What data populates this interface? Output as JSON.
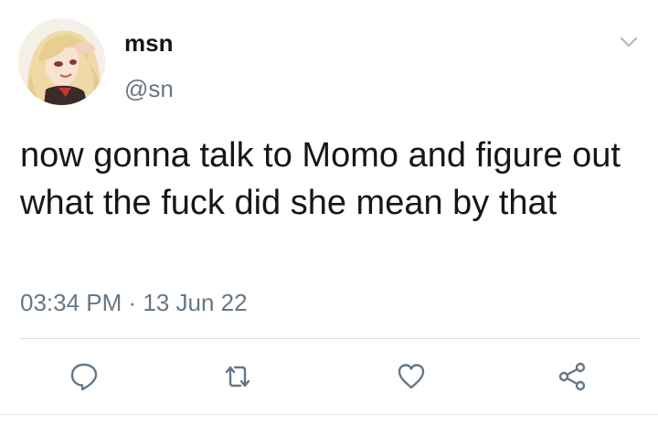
{
  "author": {
    "display_name": "msn",
    "handle": "@sn"
  },
  "tweet": {
    "text": "now gonna talk to Momo and figure out what the fuck did she mean by that",
    "timestamp": "03:34 PM · 13 Jun 22"
  },
  "icons": {
    "menu": "chevron-down-icon",
    "reply": "reply-icon",
    "retweet": "retweet-icon",
    "like": "heart-icon",
    "share": "share-icon"
  },
  "colors": {
    "text": "#14171a",
    "secondary": "#657786",
    "divider": "#d9dee2"
  }
}
